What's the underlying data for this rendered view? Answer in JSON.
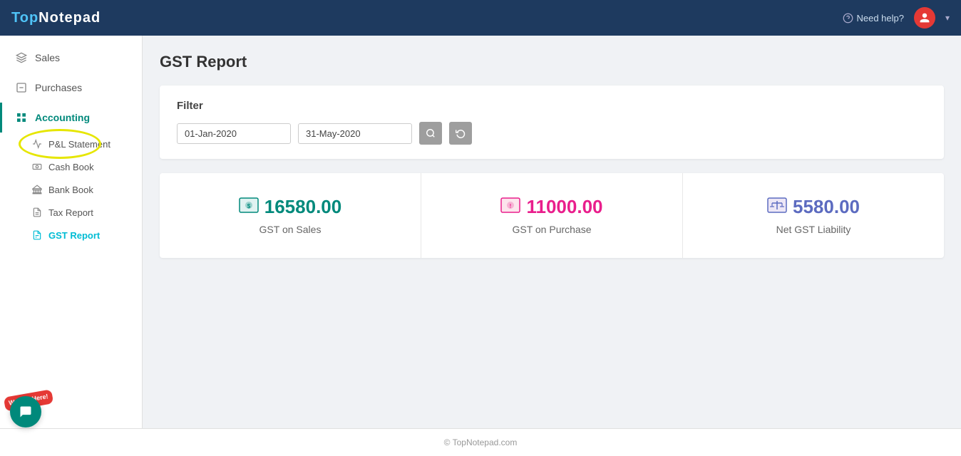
{
  "app": {
    "name": "TopNotepad",
    "name_top": "Top",
    "name_rest": "Notepad"
  },
  "topnav": {
    "need_help": "Need help?",
    "dropdown_caret": "▾"
  },
  "sidebar": {
    "items": [
      {
        "id": "sales",
        "label": "Sales",
        "icon": "layers"
      },
      {
        "id": "purchases",
        "label": "Purchases",
        "icon": "minus-square"
      },
      {
        "id": "accounting",
        "label": "Accounting",
        "icon": "grid",
        "active": true
      }
    ],
    "sub_items": [
      {
        "id": "pl-statement",
        "label": "P&L Statement",
        "icon": "chart-line"
      },
      {
        "id": "cash-book",
        "label": "Cash Book",
        "icon": "cash"
      },
      {
        "id": "bank-book",
        "label": "Bank Book",
        "icon": "bank"
      },
      {
        "id": "tax-report",
        "label": "Tax Report",
        "icon": "file-text"
      },
      {
        "id": "gst-report",
        "label": "GST Report",
        "icon": "file-list",
        "active": true
      }
    ]
  },
  "page": {
    "title": "GST Report"
  },
  "filter": {
    "label": "Filter",
    "from_date": "01-Jan-2020",
    "to_date": "31-May-2020",
    "search_label": "Search",
    "reset_label": "Reset"
  },
  "stats": [
    {
      "id": "gst-on-sales",
      "amount": "16580.00",
      "label": "GST on Sales",
      "color": "green",
      "icon": "💵"
    },
    {
      "id": "gst-on-purchase",
      "amount": "11000.00",
      "label": "GST on Purchase",
      "color": "pink",
      "icon": "💳"
    },
    {
      "id": "net-gst-liability",
      "amount": "5580.00",
      "label": "Net GST Liability",
      "color": "purple",
      "icon": "⚖"
    }
  ],
  "footer": {
    "copyright": "© TopNotepad.com"
  },
  "chat": {
    "we_are_here": "We Are Here!"
  }
}
